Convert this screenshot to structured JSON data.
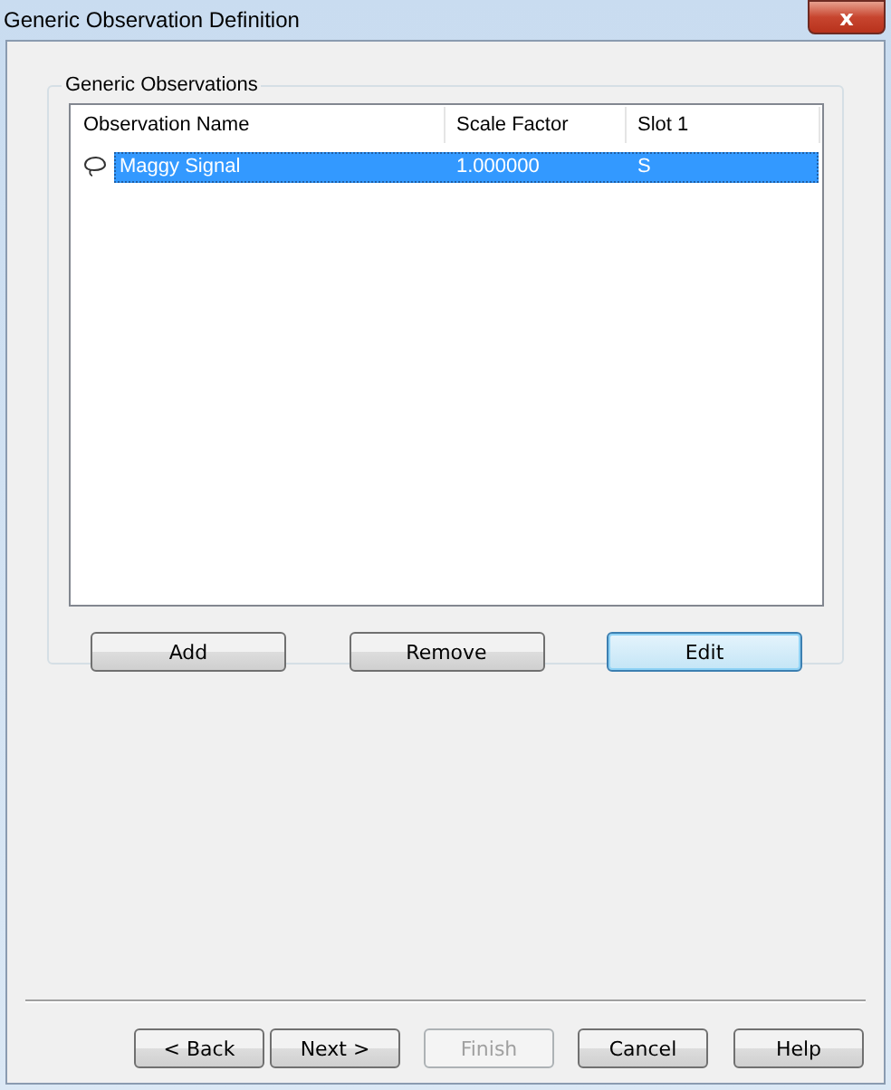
{
  "window": {
    "title": "Generic Observation Definition",
    "close": "x"
  },
  "group": {
    "title": "Generic Observations",
    "table": {
      "columns": [
        "Observation Name",
        "Scale Factor",
        "Slot 1"
      ],
      "rows": [
        {
          "cells": [
            "Maggy Signal",
            "1.000000",
            "S"
          ],
          "selected": true
        }
      ]
    },
    "buttons": [
      {
        "label": "Add",
        "default": false
      },
      {
        "label": "Remove",
        "default": false
      },
      {
        "label": "Edit",
        "default": true
      }
    ]
  },
  "footer_buttons": [
    {
      "label": "< Back",
      "disabled": false
    },
    {
      "label": "Next >",
      "disabled": false
    },
    {
      "label": "Finish",
      "disabled": true
    },
    {
      "label": "Cancel",
      "disabled": false
    },
    {
      "label": "Help",
      "disabled": false
    }
  ]
}
